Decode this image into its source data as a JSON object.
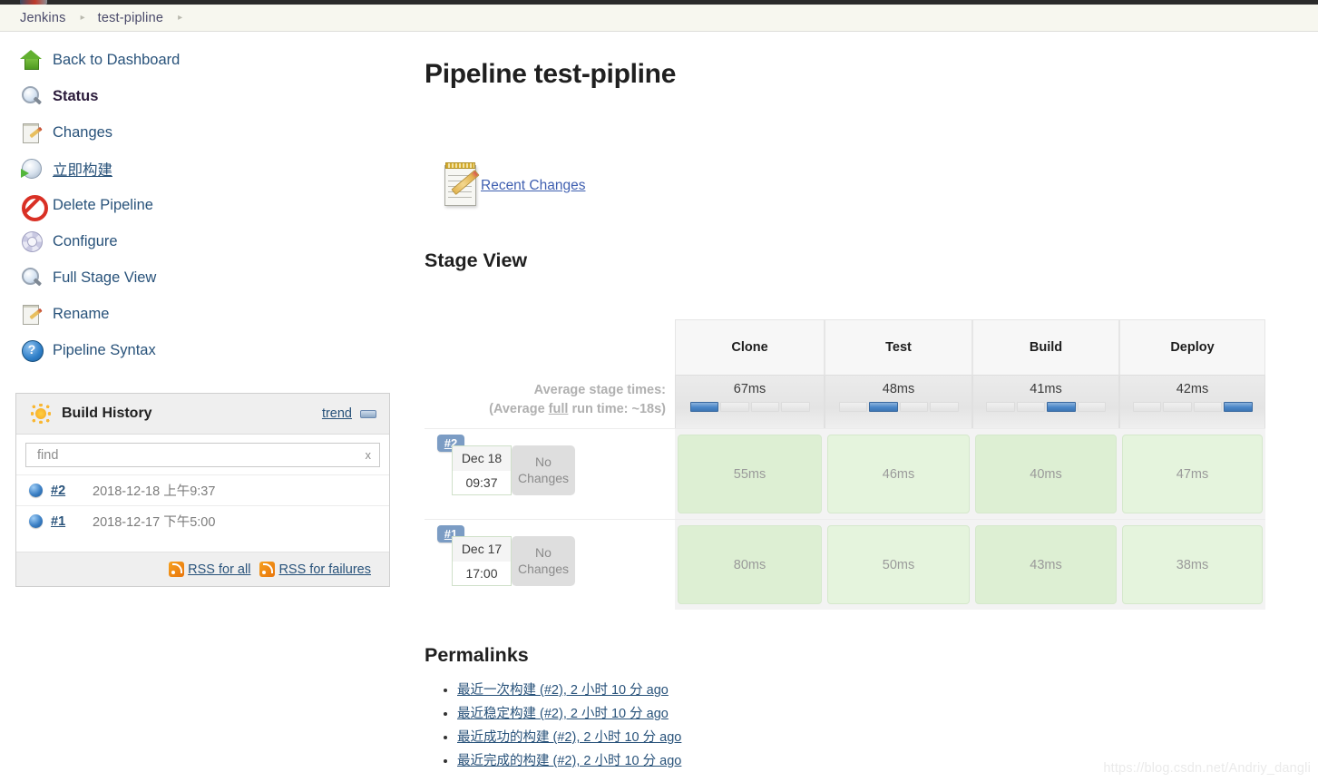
{
  "breadcrumb": {
    "items": [
      {
        "label": "Jenkins"
      },
      {
        "label": "test-pipline"
      }
    ],
    "separator": "▸"
  },
  "sidebar": {
    "items": [
      {
        "label": "Back to Dashboard",
        "icon": "arrow-up-icon",
        "style": "link"
      },
      {
        "label": "Status",
        "icon": "magnifier-icon",
        "style": "active"
      },
      {
        "label": "Changes",
        "icon": "notepad-pencil-icon",
        "style": "link"
      },
      {
        "label": "立即构建",
        "icon": "clock-play-icon",
        "style": "underline"
      },
      {
        "label": "Delete Pipeline",
        "icon": "deny-icon",
        "style": "link"
      },
      {
        "label": "Configure",
        "icon": "gear-icon",
        "style": "link"
      },
      {
        "label": "Full Stage View",
        "icon": "magnifier-icon",
        "style": "link"
      },
      {
        "label": "Rename",
        "icon": "notepad-pencil-icon",
        "style": "link"
      },
      {
        "label": "Pipeline Syntax",
        "icon": "help-icon",
        "style": "link"
      }
    ]
  },
  "build_history": {
    "title": "Build History",
    "trend_label": "trend",
    "find_placeholder": "find",
    "find_value": "",
    "clear_label": "x",
    "rows": [
      {
        "number": "#2",
        "date": "2018-12-18 上午9:37"
      },
      {
        "number": "#1",
        "date": "2018-12-17 下午5:00"
      }
    ],
    "rss_all": "RSS for all",
    "rss_failures": "RSS for failures"
  },
  "main": {
    "page_title": "Pipeline test-pipline",
    "recent_changes_link": "Recent Changes",
    "stage_view_heading": "Stage View",
    "permalinks_heading": "Permalinks"
  },
  "stage_view": {
    "avg_label_line1": "Average stage times:",
    "avg_label_line2_pre": "(Average ",
    "avg_label_line2_u": "full",
    "avg_label_line2_post": " run time: ~18s)",
    "stages": [
      "Clone",
      "Test",
      "Build",
      "Deploy"
    ],
    "averages": [
      "67ms",
      "48ms",
      "41ms",
      "42ms"
    ],
    "bar_segments": 4,
    "bar_active_index": [
      0,
      1,
      2,
      3
    ],
    "builds": [
      {
        "number": "#2",
        "day": "Dec 18",
        "time": "09:37",
        "changes": "No Changes",
        "durations": [
          "55ms",
          "46ms",
          "40ms",
          "47ms"
        ],
        "shades": [
          "shade-a",
          "shade-b",
          "shade-a",
          "shade-b"
        ]
      },
      {
        "number": "#1",
        "day": "Dec 17",
        "time": "17:00",
        "changes": "No Changes",
        "durations": [
          "80ms",
          "50ms",
          "43ms",
          "38ms"
        ],
        "shades": [
          "shade-a",
          "shade-b",
          "shade-a",
          "shade-b"
        ]
      }
    ]
  },
  "permalinks": {
    "items": [
      "最近一次构建 (#2), 2 小时 10 分 ago",
      "最近稳定构建 (#2), 2 小时 10 分 ago",
      "最近成功的构建 (#2), 2 小时 10 分 ago",
      "最近完成的构建 (#2), 2 小时 10 分 ago"
    ]
  },
  "watermark": "https://blog.csdn.net/Andriy_dangli",
  "colors": {
    "breadcrumb_bg": "#f7f7ef",
    "link": "#28527a",
    "stage_green_a": "#ddefd3",
    "stage_green_b": "#e5f4dd",
    "bar_blue": "#4a86c8",
    "badge_blue": "#7b9cc4",
    "rss_orange": "#e8740c"
  }
}
